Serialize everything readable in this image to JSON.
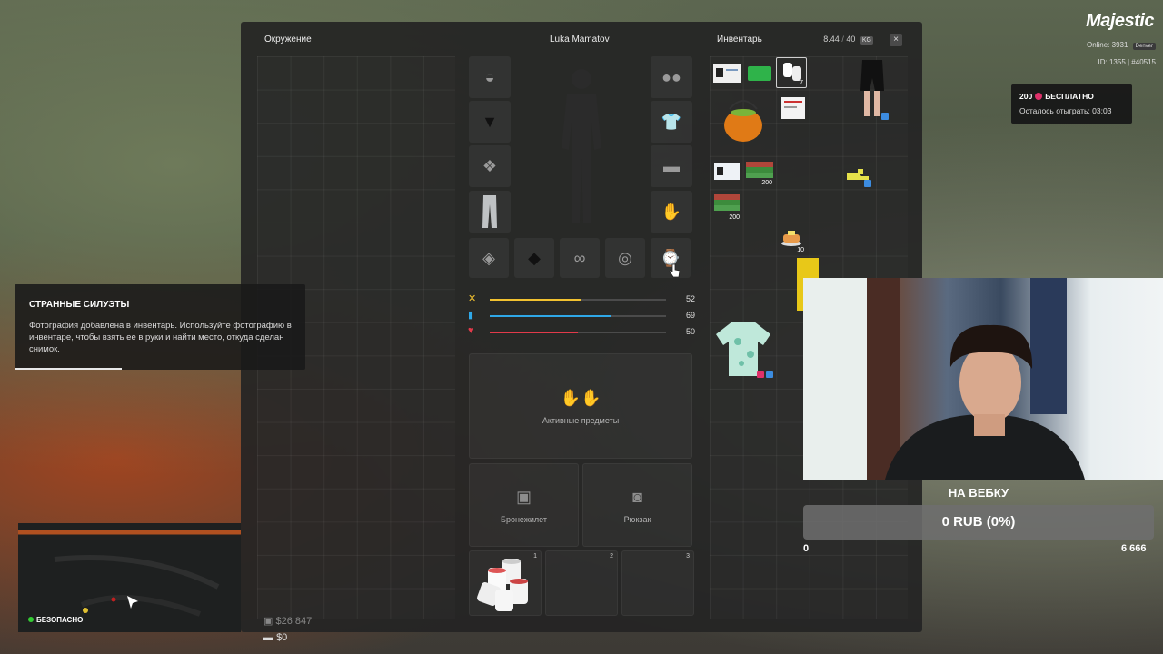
{
  "panel": {
    "surroundings_title": "Окружение",
    "character_name": "Luka Mamatov",
    "inventory_title": "Инвентарь",
    "weight_current": "8.44",
    "weight_max": "40",
    "weight_unit": "KG",
    "close_label": "×"
  },
  "stats": [
    {
      "name": "hunger",
      "icon": "fork-knife-icon",
      "value": "52",
      "color": "#f2c230",
      "fill": 0.52
    },
    {
      "name": "thirst",
      "icon": "cup-icon",
      "value": "69",
      "color": "#2fa8e8",
      "fill": 0.69
    },
    {
      "name": "health",
      "icon": "heart-icon",
      "value": "50",
      "color": "#e23a4a",
      "fill": 0.5
    }
  ],
  "active_items_label": "Активные предметы",
  "vest_label": "Бронежилет",
  "backpack_label": "Рюкзак",
  "quick_slots": [
    "1",
    "2",
    "3"
  ],
  "inventory_badges": {
    "toilet_paper_count": "7",
    "cash_stack_1": "200",
    "cash_stack_2": "200",
    "pancakes_count": "10"
  },
  "notification": {
    "title": "СТРАННЫЕ СИЛУЭТЫ",
    "text": "Фотография добавлена в инвентарь. Используйте фотографию в инвентаре, чтобы взять ее в руки и найти место, откуда сделан снимок.",
    "progress": 0.37
  },
  "minimap": {
    "zone_status": "БЕЗОПАСНО"
  },
  "hud": {
    "logo": "Majestic",
    "online_label": "Online:",
    "online_count": "3931",
    "server_tag": "Denver",
    "id_line": "ID: 1355 | #40515",
    "bonus_amount": "200",
    "bonus_label": "БЕСПЛАТНО",
    "bonus_timer": "Осталось отыграть: 03:03",
    "cash": "$26 847",
    "bank": "$0"
  },
  "donation": {
    "title": "НА ВЕБКУ",
    "progress_text": "0 RUB (0%)",
    "min": "0",
    "max": "6 666"
  },
  "colors": {
    "accent_pink": "#e0306a",
    "accent_blue": "#3c8ce0"
  }
}
